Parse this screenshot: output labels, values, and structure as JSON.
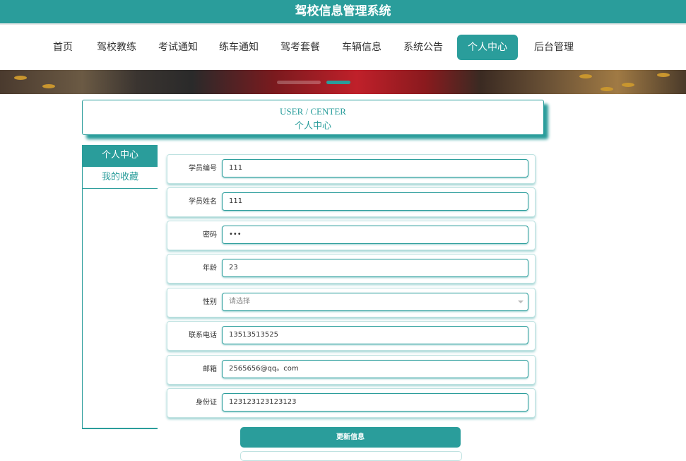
{
  "app": {
    "title": "驾校信息管理系统"
  },
  "nav": {
    "items": [
      "首页",
      "驾校教练",
      "考试通知",
      "练车通知",
      "驾考套餐",
      "车辆信息",
      "系统公告",
      "个人中心",
      "后台管理"
    ],
    "active_index": 7
  },
  "header": {
    "title_en": "USER / CENTER",
    "title_cn": "个人中心"
  },
  "sidebar": {
    "items": [
      "个人中心",
      "我的收藏"
    ],
    "active_index": 0
  },
  "form": {
    "student_id": {
      "label": "学员编号",
      "value": "111"
    },
    "student_name": {
      "label": "学员姓名",
      "value": "111"
    },
    "password": {
      "label": "密码",
      "value": "•••"
    },
    "age": {
      "label": "年龄",
      "value": "23"
    },
    "gender": {
      "label": "性别",
      "placeholder": "请选择"
    },
    "phone": {
      "label": "联系电话",
      "value": "13513513525"
    },
    "email": {
      "label": "邮箱",
      "value": "2565656@qq。com"
    },
    "id_card": {
      "label": "身份证",
      "value": "123123123123123"
    },
    "submit_label": "更新信息"
  },
  "colors": {
    "accent": "#2a9d9b"
  }
}
